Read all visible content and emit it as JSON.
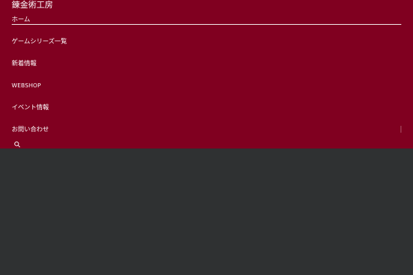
{
  "site": {
    "title": "錬金術工房"
  },
  "navigation": {
    "items": [
      {
        "label": "ホーム"
      },
      {
        "label": "ゲームシリーズ一覧"
      },
      {
        "label": "新着情報"
      },
      {
        "label": "WEBSHOP"
      },
      {
        "label": "イベント情報"
      },
      {
        "label": "お問い合わせ"
      }
    ],
    "active_index": 0
  },
  "search": {
    "icon": "search-icon"
  },
  "colors": {
    "menu_background": "#800020",
    "page_background": "#2f3132",
    "text": "#ffffff"
  }
}
